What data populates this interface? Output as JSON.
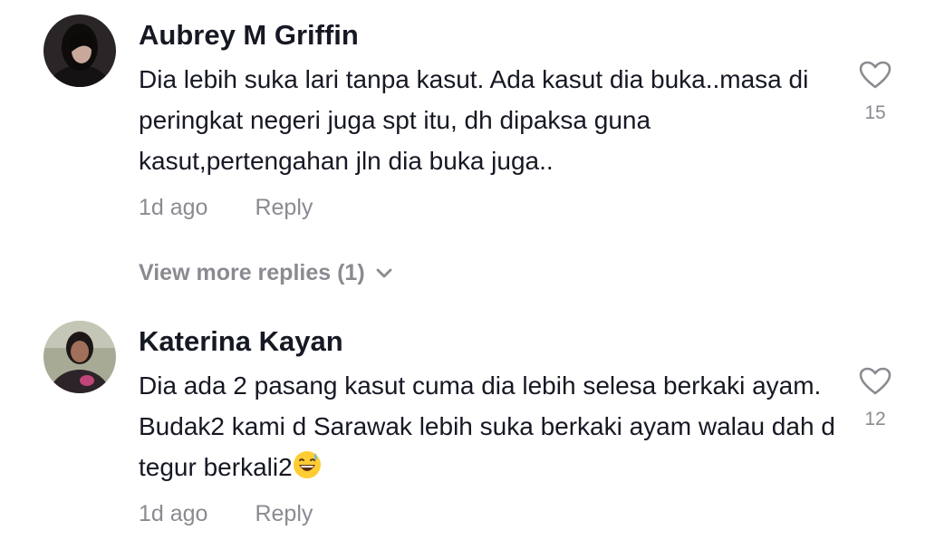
{
  "comments": [
    {
      "username": "Aubrey M Griffin",
      "text": "Dia lebih suka lari tanpa kasut. Ada kasut dia buka..masa di peringkat negeri juga spt itu, dh dipaksa guna kasut,pertengahan jln dia buka juga..",
      "time": "1d ago",
      "reply_label": "Reply",
      "likes": "15",
      "avatar_icon": "user-photo-dark-hair"
    },
    {
      "username": "Katerina Kayan",
      "text": "Dia ada 2 pasang kasut cuma dia lebih selesa berkaki ayam. Budak2 kami d Sarawak lebih suka berkaki ayam walau dah d tegur berkali2",
      "emoji": "😅",
      "time": "1d ago",
      "reply_label": "Reply",
      "likes": "12",
      "avatar_icon": "user-photo-outdoor"
    }
  ],
  "view_more": {
    "label": "View more replies (1)",
    "icon": "chevron-down-icon"
  },
  "colors": {
    "text_primary": "#161823",
    "text_secondary": "#8a8b91",
    "icon": "#8a8b91"
  }
}
